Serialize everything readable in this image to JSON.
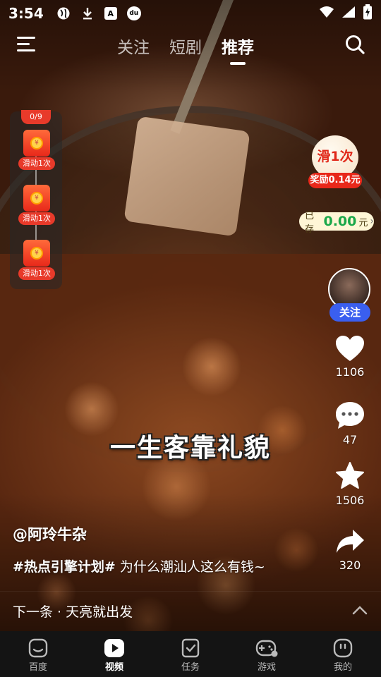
{
  "status_bar": {
    "time": "3:54",
    "left_icons": [
      "globe-icon",
      "download-icon",
      "a-box-icon",
      "app-badge-icon"
    ],
    "right_icons": [
      "wifi-icon",
      "signal-icon",
      "battery-charging-icon"
    ],
    "a_box_letter": "A",
    "badge_letter": "du"
  },
  "top_nav": {
    "tabs": [
      {
        "label": "关注",
        "active": false
      },
      {
        "label": "短剧",
        "active": false
      },
      {
        "label": "推荐",
        "active": true
      }
    ]
  },
  "reward_task": {
    "counter": "0/9",
    "items": [
      {
        "label": "滑动1次"
      },
      {
        "label": "滑动1次"
      },
      {
        "label": "滑动1次"
      }
    ]
  },
  "slide_reward": {
    "bubble_text": "滑1次",
    "reward_text": "奖励0.14元",
    "saved_prefix": "已存",
    "saved_amount": "0.00",
    "saved_unit": "元"
  },
  "actions": {
    "follow_label": "关注",
    "likes": "1106",
    "comments": "47",
    "favorites": "1506",
    "shares": "320"
  },
  "video": {
    "overlay_caption": "一生客靠礼貌",
    "author": "@阿玲牛杂",
    "hashtag": "#热点引擎计划#",
    "description": " 为什么潮汕人这么有钱~"
  },
  "next_bar": {
    "text": "下一条 · 天亮就出发"
  },
  "bottom_nav": [
    {
      "label": "百度",
      "icon": "baidu-icon",
      "active": false
    },
    {
      "label": "视频",
      "icon": "video-play-icon",
      "active": true
    },
    {
      "label": "任务",
      "icon": "task-check-icon",
      "active": false
    },
    {
      "label": "游戏",
      "icon": "gamepad-icon",
      "active": false
    },
    {
      "label": "我的",
      "icon": "profile-face-icon",
      "active": false
    }
  ],
  "colors": {
    "reward_red": "#e8281a",
    "follow_blue": "#3a5ff0",
    "saved_green": "#1aa84a"
  }
}
